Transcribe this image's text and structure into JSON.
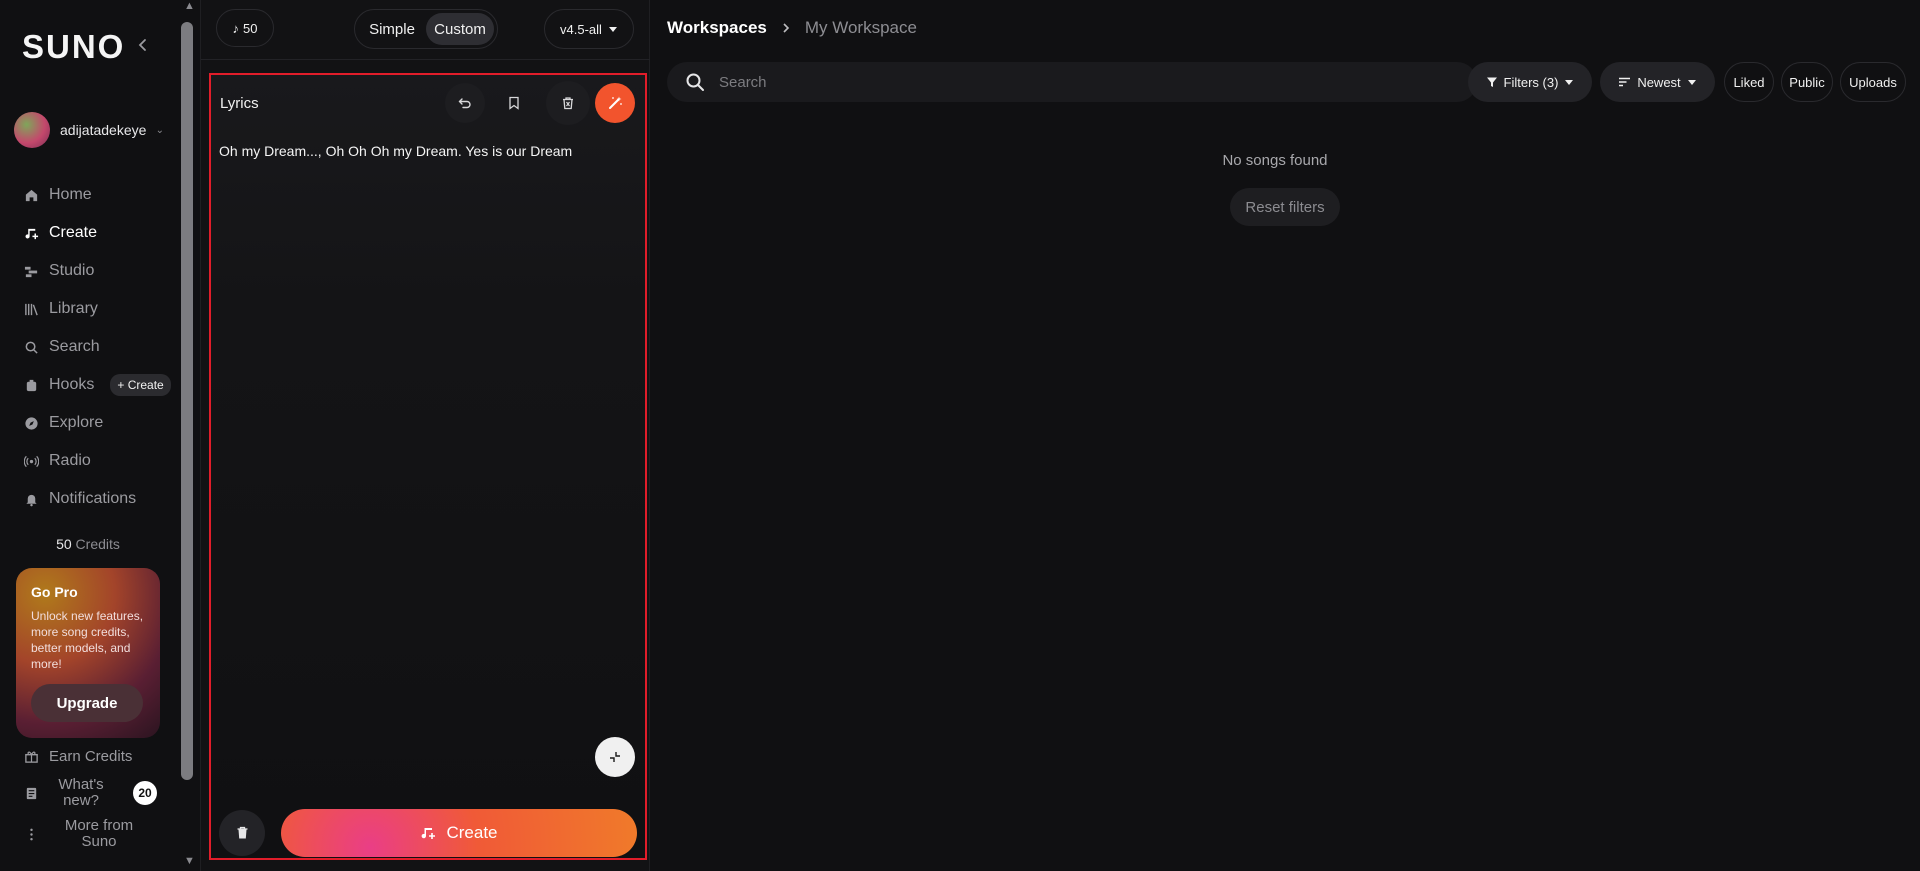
{
  "sidebar": {
    "logo": "SUNO",
    "username": "adijatadekeye",
    "nav": [
      {
        "label": "Home",
        "icon": "home-icon"
      },
      {
        "label": "Create",
        "icon": "music-note-icon",
        "active": true
      },
      {
        "label": "Studio",
        "icon": "studio-icon"
      },
      {
        "label": "Library",
        "icon": "library-icon"
      },
      {
        "label": "Search",
        "icon": "search-icon"
      },
      {
        "label": "Hooks",
        "icon": "hooks-icon",
        "badge": "+ Create"
      },
      {
        "label": "Explore",
        "icon": "compass-icon"
      },
      {
        "label": "Radio",
        "icon": "radio-icon"
      },
      {
        "label": "Notifications",
        "icon": "bell-icon"
      }
    ],
    "credits_value": "50",
    "credits_label": " Credits",
    "gopro": {
      "title": "Go Pro",
      "text": "Unlock new features, more song credits, better models, and more!",
      "button": "Upgrade"
    },
    "earn_credits": "Earn Credits",
    "whats_new": "What's new?",
    "whats_new_count": "20",
    "more_from": "More from Suno"
  },
  "topbar": {
    "credits": "50",
    "mode_simple": "Simple",
    "mode_custom": "Custom",
    "version": "v4.5-all"
  },
  "lyrics": {
    "label": "Lyrics",
    "text": "Oh my Dream..., Oh Oh Oh my Dream. Yes is our Dream",
    "create_label": "Create"
  },
  "workspace": {
    "breadcrumb_root": "Workspaces",
    "breadcrumb_current": "My Workspace",
    "search_placeholder": "Search",
    "filters_label": "Filters (3)",
    "sort_label": "Newest",
    "liked_label": "Liked",
    "public_label": "Public",
    "uploads_label": "Uploads",
    "empty_message": "No songs found",
    "reset_label": "Reset filters"
  },
  "colors": {
    "accent": "#f2542d",
    "highlight_border": "#e11d2a",
    "background": "#101012"
  }
}
